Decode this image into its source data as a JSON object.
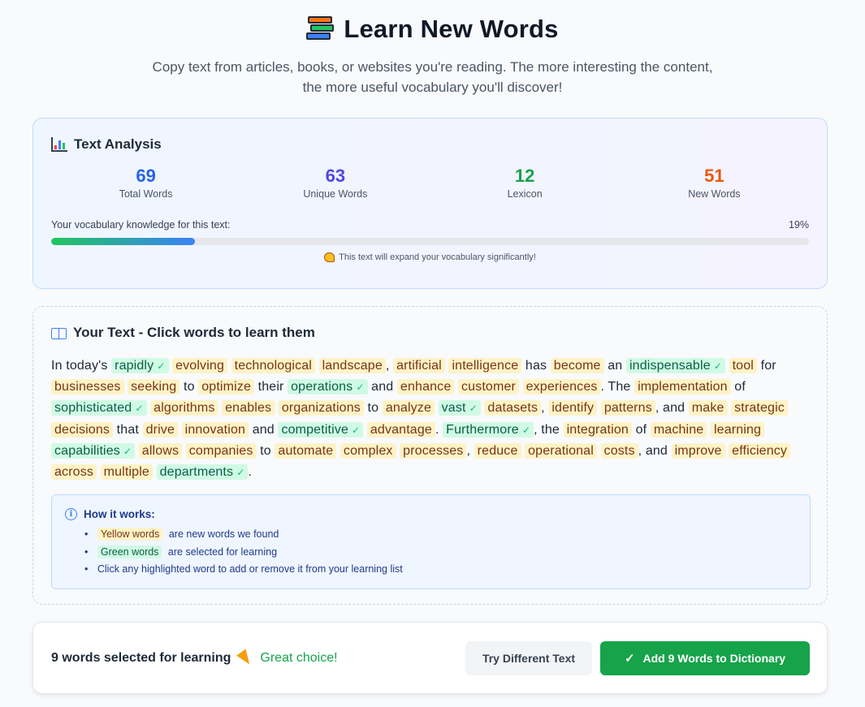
{
  "header": {
    "title": "Learn New Words",
    "subtitle": "Copy text from articles, books, or websites you're reading. The more interesting the content, the more useful vocabulary you'll discover!"
  },
  "analysis": {
    "title": "Text Analysis",
    "stats": [
      {
        "value": "69",
        "label": "Total Words",
        "color": "#2563eb"
      },
      {
        "value": "63",
        "label": "Unique Words",
        "color": "#4f46e5"
      },
      {
        "value": "12",
        "label": "Lexicon",
        "color": "#16a34a"
      },
      {
        "value": "51",
        "label": "New Words",
        "color": "#ea580c"
      }
    ],
    "progress_label": "Your vocabulary knowledge for this text:",
    "progress_percent": "19%",
    "progress_value": 19,
    "note": "This text will expand your vocabulary significantly!"
  },
  "text_section": {
    "title": "Your Text - Click words to learn them",
    "tokens": [
      {
        "t": "In today's",
        "k": "plain"
      },
      {
        "t": "rapidly",
        "k": "sel"
      },
      {
        "t": "evolving",
        "k": "new"
      },
      {
        "t": "technological",
        "k": "new"
      },
      {
        "t": "landscape",
        "k": "new"
      },
      {
        "t": ",",
        "k": "punct"
      },
      {
        "t": "artificial",
        "k": "new"
      },
      {
        "t": "intelligence",
        "k": "new"
      },
      {
        "t": "has",
        "k": "plain"
      },
      {
        "t": "become",
        "k": "new"
      },
      {
        "t": "an",
        "k": "plain"
      },
      {
        "t": "indispensable",
        "k": "sel"
      },
      {
        "t": "tool",
        "k": "new"
      },
      {
        "t": "for",
        "k": "plain"
      },
      {
        "t": "businesses",
        "k": "new"
      },
      {
        "t": "seeking",
        "k": "new"
      },
      {
        "t": "to",
        "k": "plain"
      },
      {
        "t": "optimize",
        "k": "new"
      },
      {
        "t": "their",
        "k": "plain"
      },
      {
        "t": "operations",
        "k": "sel"
      },
      {
        "t": "and",
        "k": "plain"
      },
      {
        "t": "enhance",
        "k": "new"
      },
      {
        "t": "customer",
        "k": "new"
      },
      {
        "t": "experiences",
        "k": "new"
      },
      {
        "t": ". The",
        "k": "punct"
      },
      {
        "t": "implementation",
        "k": "new"
      },
      {
        "t": "of",
        "k": "plain"
      },
      {
        "t": "sophisticated",
        "k": "sel"
      },
      {
        "t": "algorithms",
        "k": "new"
      },
      {
        "t": "enables",
        "k": "new"
      },
      {
        "t": "organizations",
        "k": "new"
      },
      {
        "t": "to",
        "k": "plain"
      },
      {
        "t": "analyze",
        "k": "new"
      },
      {
        "t": "vast",
        "k": "sel"
      },
      {
        "t": "datasets",
        "k": "new"
      },
      {
        "t": ",",
        "k": "punct"
      },
      {
        "t": "identify",
        "k": "new"
      },
      {
        "t": "patterns",
        "k": "new"
      },
      {
        "t": ", and",
        "k": "punct"
      },
      {
        "t": "make",
        "k": "new"
      },
      {
        "t": "strategic",
        "k": "new"
      },
      {
        "t": "decisions",
        "k": "new"
      },
      {
        "t": "that",
        "k": "plain"
      },
      {
        "t": "drive",
        "k": "new"
      },
      {
        "t": "innovation",
        "k": "new"
      },
      {
        "t": "and",
        "k": "plain"
      },
      {
        "t": "competitive",
        "k": "sel"
      },
      {
        "t": "advantage",
        "k": "new"
      },
      {
        "t": ".",
        "k": "punct"
      },
      {
        "t": "Furthermore",
        "k": "sel"
      },
      {
        "t": ", the",
        "k": "punct"
      },
      {
        "t": "integration",
        "k": "new"
      },
      {
        "t": "of",
        "k": "plain"
      },
      {
        "t": "machine",
        "k": "new"
      },
      {
        "t": "learning",
        "k": "new"
      },
      {
        "t": "capabilities",
        "k": "sel"
      },
      {
        "t": "allows",
        "k": "new"
      },
      {
        "t": "companies",
        "k": "new"
      },
      {
        "t": "to",
        "k": "plain"
      },
      {
        "t": "automate",
        "k": "new"
      },
      {
        "t": "complex",
        "k": "new"
      },
      {
        "t": "processes",
        "k": "new"
      },
      {
        "t": ",",
        "k": "punct"
      },
      {
        "t": "reduce",
        "k": "new"
      },
      {
        "t": "operational",
        "k": "new"
      },
      {
        "t": "costs",
        "k": "new"
      },
      {
        "t": ", and",
        "k": "punct"
      },
      {
        "t": "improve",
        "k": "new"
      },
      {
        "t": "efficiency",
        "k": "new"
      },
      {
        "t": "across",
        "k": "new"
      },
      {
        "t": "multiple",
        "k": "new"
      },
      {
        "t": "departments",
        "k": "sel"
      },
      {
        "t": ".",
        "k": "punct"
      }
    ],
    "check_mark": "✓",
    "how": {
      "title": "How it works:",
      "yellow_chip": "Yellow words",
      "yellow_text": "are new words we found",
      "green_chip": "Green words",
      "green_text": "are selected for learning",
      "click_text": "Click any highlighted word to add or remove it from your learning list"
    }
  },
  "action_bar": {
    "selected_text": "9 words selected for learning",
    "great_text": "Great choice!",
    "try_button": "Try Different Text",
    "add_button": "Add 9 Words to Dictionary",
    "check": "✓"
  },
  "icons": {
    "title": "books-icon",
    "analysis": "bar-chart-icon",
    "note": "flexed-biceps-icon",
    "text": "open-book-icon",
    "how": "info-icon",
    "great": "party-popper-icon",
    "add": "check-icon"
  }
}
